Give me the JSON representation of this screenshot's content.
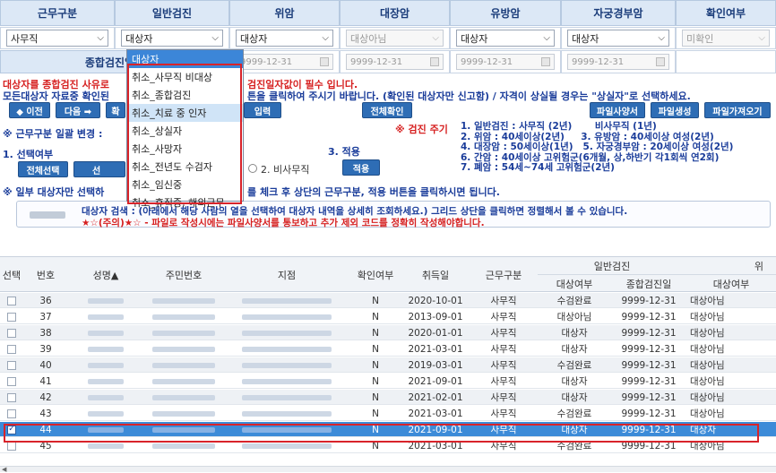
{
  "header": {
    "cols": [
      "근무구분",
      "일반검진",
      "위암",
      "대장암",
      "유방암",
      "자궁경부암",
      "확인여부"
    ],
    "selects": [
      {
        "value": "사무직",
        "disabled": false
      },
      {
        "value": "대상자",
        "disabled": false
      },
      {
        "value": "대상자",
        "disabled": false
      },
      {
        "value": "대상아님",
        "disabled": true
      },
      {
        "value": "대상자",
        "disabled": false
      },
      {
        "value": "대상자",
        "disabled": false
      },
      {
        "value": "미확인",
        "disabled": true
      }
    ],
    "date_label": "종합검진일자",
    "dates": [
      "9999-12-31",
      "9999-12-31",
      "9999-12-31",
      "9999-12-31"
    ]
  },
  "notice": {
    "line1_prefix": "대상자를 종합검진 사유로",
    "line1_suffix": "검진일자값이 필수 입니다.",
    "line2_prefix": "모든대상자 자료중 확인된",
    "line2_suffix": "튼을 클릭하여 주시기 바랍니다. (확인된 대상자만 신고함) / 자격이 상실될 경우는 \"상실자\"로 선택하세요."
  },
  "toolbar": {
    "prev": "◆ 이전",
    "next": "다음 ➡",
    "confirm_partial": "확",
    "input_partial": "입력",
    "confirm_all": "전체확인",
    "file_spec": "파일사양서",
    "file_create": "파일생성",
    "file_import": "파일가져오기"
  },
  "bulk": {
    "title": "※ 근무구분 일괄 변경 :",
    "step1": "1. 선택여부",
    "select_all": "전체선택",
    "select_partial": "선",
    "step3": "3. 적용",
    "radio2": "2. 비사무직",
    "apply": "적용",
    "footnote": "※ 일부 대상자만 선택하",
    "footnote_tail": "를 체크 후 상단의 근무구분, 적용 버튼을 클릭하시면 됩니다."
  },
  "criteria": {
    "title": "※ 검진 주기",
    "lines": [
      "1. 일반검진 : 사무직 (2년)       비사무직 (1년)",
      "2. 위암 : 40세이상(2년)     3. 유방암 : 40세이상 여성(2년)",
      "4. 대장암 : 50세이상(1년)   5. 자궁경부암 : 20세이상 여성(2년)",
      "6. 간암 : 40세이상 고위험군(6개월, 상,하반기 각1회씩 연2회)",
      "7. 폐암 : 54세~74세 고위험군(2년)"
    ]
  },
  "info": {
    "line1": "대상자 검색 : (아래에서 해당 사람의 열을 선택하여 대상자 내역을 상세히 조회하세요.) 그리드 상단을 클릭하면 정렬해서 볼 수 있습니다.",
    "line2": "★☆(주의)★☆ - 파일로 작성시에는 파일사양서를 통보하고 추가 제외 코드를 정확히 작성해야합니다."
  },
  "dropdown": {
    "items": [
      "대상자",
      "취소_사무직 비대상",
      "취소_종합검진",
      "취소_치료 중 인자",
      "취소_상실자",
      "취소_사망자",
      "취소_전년도 수검자",
      "취소_임신중",
      "취소_휴직중, 해외근무"
    ]
  },
  "grid": {
    "headers": {
      "select": "선택",
      "no": "번호",
      "name": "성명▲",
      "rrn": "주민번호",
      "branch": "지점",
      "confirm": "확인여부",
      "hire": "취득일",
      "work": "근무구분",
      "general": "일반검진",
      "target": "대상여부",
      "exam_date": "종합검진일",
      "target2": "대상여부",
      "next_group": "위"
    },
    "rows": [
      {
        "no": "36",
        "confirm": "N",
        "hire": "2020-10-01",
        "work": "사무직",
        "target": "수검완료",
        "exam": "9999-12-31",
        "target2": "대상아님",
        "checked": false
      },
      {
        "no": "37",
        "confirm": "N",
        "hire": "2013-09-01",
        "work": "사무직",
        "target": "대상아님",
        "exam": "9999-12-31",
        "target2": "대상아님",
        "checked": false
      },
      {
        "no": "38",
        "confirm": "N",
        "hire": "2020-01-01",
        "work": "사무직",
        "target": "대상자",
        "exam": "9999-12-31",
        "target2": "대상아님",
        "checked": false
      },
      {
        "no": "39",
        "confirm": "N",
        "hire": "2021-03-01",
        "work": "사무직",
        "target": "대상자",
        "exam": "9999-12-31",
        "target2": "대상아님",
        "checked": false
      },
      {
        "no": "40",
        "confirm": "N",
        "hire": "2019-03-01",
        "work": "사무직",
        "target": "수검완료",
        "exam": "9999-12-31",
        "target2": "대상아님",
        "checked": false
      },
      {
        "no": "41",
        "confirm": "N",
        "hire": "2021-09-01",
        "work": "사무직",
        "target": "대상자",
        "exam": "9999-12-31",
        "target2": "대상아님",
        "checked": false
      },
      {
        "no": "42",
        "confirm": "N",
        "hire": "2021-02-01",
        "work": "사무직",
        "target": "대상자",
        "exam": "9999-12-31",
        "target2": "대상아님",
        "checked": false
      },
      {
        "no": "43",
        "confirm": "N",
        "hire": "2021-03-01",
        "work": "사무직",
        "target": "수검완료",
        "exam": "9999-12-31",
        "target2": "대상아님",
        "checked": false
      },
      {
        "no": "44",
        "confirm": "N",
        "hire": "2021-09-01",
        "work": "사무직",
        "target": "대상자",
        "exam": "9999-12-31",
        "target2": "대상자",
        "checked": true
      },
      {
        "no": "45",
        "confirm": "N",
        "hire": "2021-03-01",
        "work": "사무직",
        "target": "수검완료",
        "exam": "9999-12-31",
        "target2": "대상아님",
        "checked": false
      }
    ]
  },
  "colors": {
    "accent": "#2e6db5",
    "header_bg": "#dce8f6",
    "selection": "#3c8bd8",
    "alert_red": "#d61f1f",
    "highlight_frame": "#d8232a"
  }
}
